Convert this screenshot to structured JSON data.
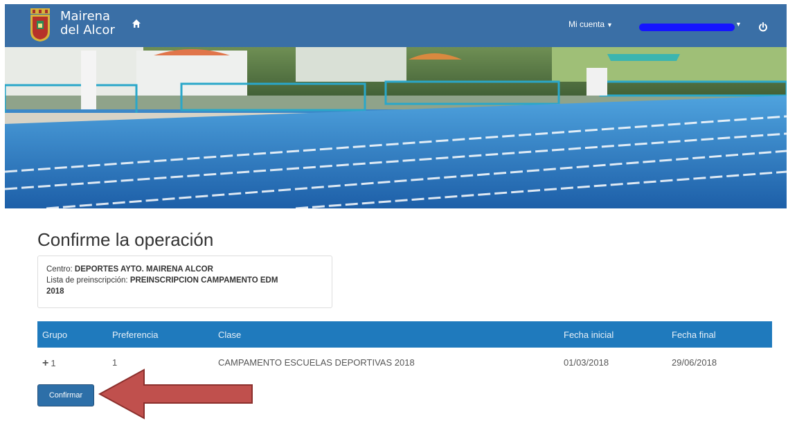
{
  "header": {
    "brand_line1": "Mairena",
    "brand_line2": "del Alcor",
    "account_label": "Mi cuenta",
    "colors": {
      "navbar": "#3a6fa6",
      "redaction": "#1515ff"
    }
  },
  "page": {
    "title": "Confirme la operación"
  },
  "info": {
    "centro_label": "Centro:",
    "centro_value": "DEPORTES AYTO. MAIRENA ALCOR",
    "lista_label": "Lista de preinscripción:",
    "lista_value": "PREINSCRIPCION CAMPAMENTO EDM",
    "lista_year": "2018"
  },
  "table": {
    "headers": [
      "Grupo",
      "Preferencia",
      "Clase",
      "Fecha inicial",
      "Fecha final"
    ],
    "rows": [
      {
        "grupo": "1",
        "preferencia": "1",
        "clase": "CAMPAMENTO ESCUELAS DEPORTIVAS 2018",
        "fecha_inicial": "01/03/2018",
        "fecha_final": "29/06/2018"
      }
    ],
    "header_color": "#1f7abd"
  },
  "actions": {
    "confirm_label": "Confirmar"
  },
  "annotation": {
    "arrow_color": "#c0504d"
  }
}
